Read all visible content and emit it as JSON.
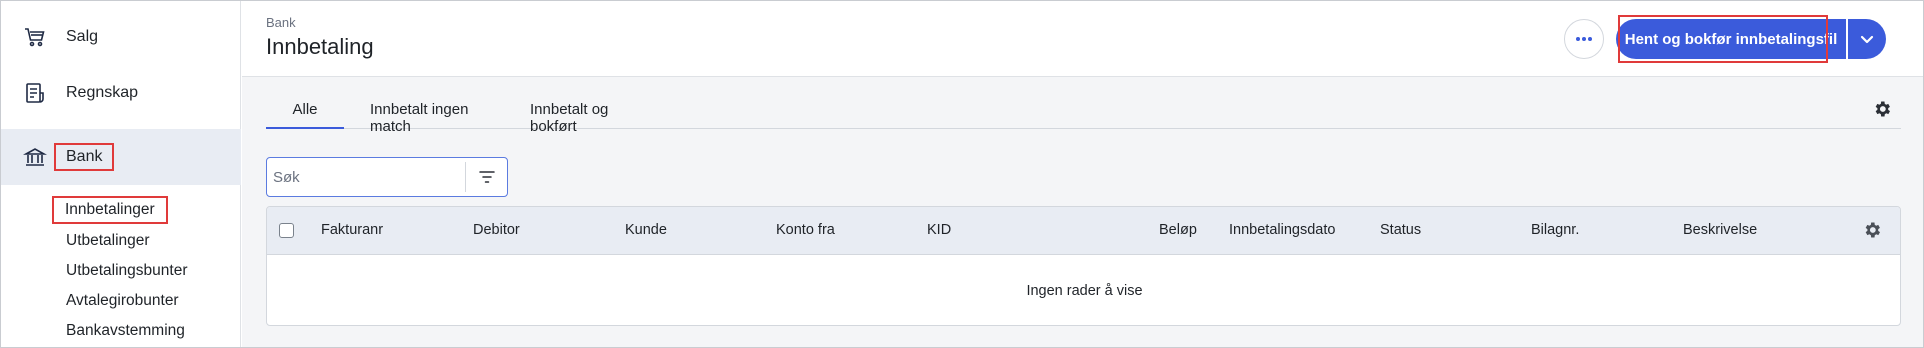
{
  "sidebar": {
    "items": [
      {
        "label": "Salg",
        "icon": "cart-icon"
      },
      {
        "label": "Regnskap",
        "icon": "ledger-icon"
      },
      {
        "label": "Bank",
        "icon": "bank-icon"
      }
    ],
    "sub_items": [
      "Innbetalinger",
      "Utbetalinger",
      "Utbetalingsbunter",
      "Avtalegirobunter",
      "Bankavstemming"
    ]
  },
  "header": {
    "breadcrumb": "Bank",
    "title": "Innbetaling",
    "primary_button": "Hent og bokfør innbetalingsfil"
  },
  "tabs": [
    "Alle",
    "Innbetalt ingen match",
    "Innbetalt og bokført"
  ],
  "search": {
    "placeholder": "Søk"
  },
  "table": {
    "columns": [
      "Fakturanr",
      "Debitor",
      "Kunde",
      "Konto fra",
      "KID",
      "Beløp",
      "Innbetalingsdato",
      "Status",
      "Bilagnr.",
      "Beskrivelse"
    ],
    "empty_message": "Ingen rader å vise"
  },
  "colors": {
    "accent": "#3b5bdb",
    "highlight": "#e03a3a",
    "active_bg": "#e8ecf3"
  }
}
